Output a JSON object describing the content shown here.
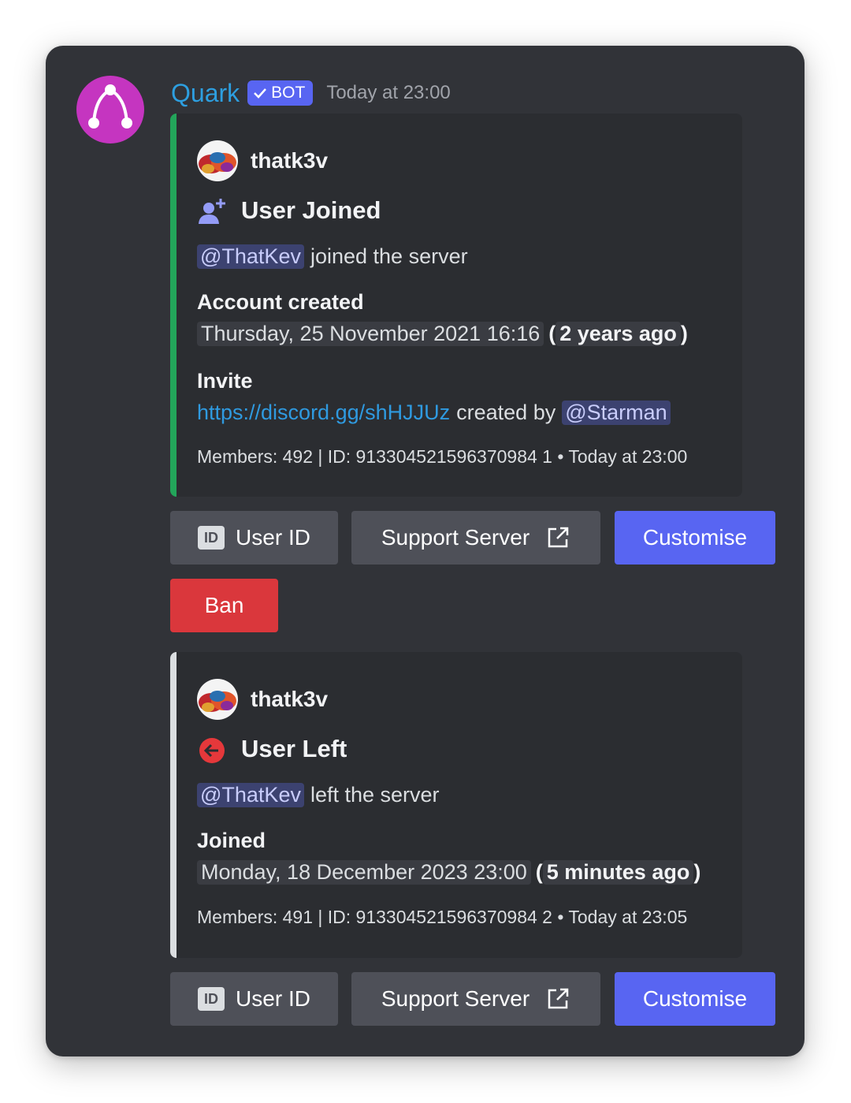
{
  "bot": {
    "name": "Quark",
    "badge": "BOT",
    "timestamp": "Today at 23:00",
    "avatar_color": "#c535c0"
  },
  "embeds": [
    {
      "accent": "#23a55a",
      "author": "thatk3v",
      "title": "User Joined",
      "title_icon": "user-add-icon",
      "mention": "@ThatKev",
      "action_text": "joined the server",
      "field_name": "Account created",
      "date": "Thursday, 25 November 2021 16:16",
      "relative": "2 years ago",
      "invite_label": "Invite",
      "invite_link": "https://discord.gg/shHJJUz",
      "created_by": "created by",
      "inviter": "@Starman",
      "footer": "Members: 492 | ID: 913304521596370984 1 • Today at 23:00"
    },
    {
      "accent": "#dbdee1",
      "author": "thatk3v",
      "title": "User Left",
      "title_icon": "leave-arrow-icon",
      "mention": "@ThatKev",
      "action_text": "left the server",
      "field_name": "Joined",
      "date": "Monday, 18 December 2023 23:00",
      "relative": "5 minutes ago",
      "footer": "Members: 491 | ID: 913304521596370984 2 • Today at 23:05"
    }
  ],
  "buttons": {
    "id_icon_text": "ID",
    "user_id": "User ID",
    "support_server": "Support Server",
    "customise": "Customise",
    "ban": "Ban"
  }
}
